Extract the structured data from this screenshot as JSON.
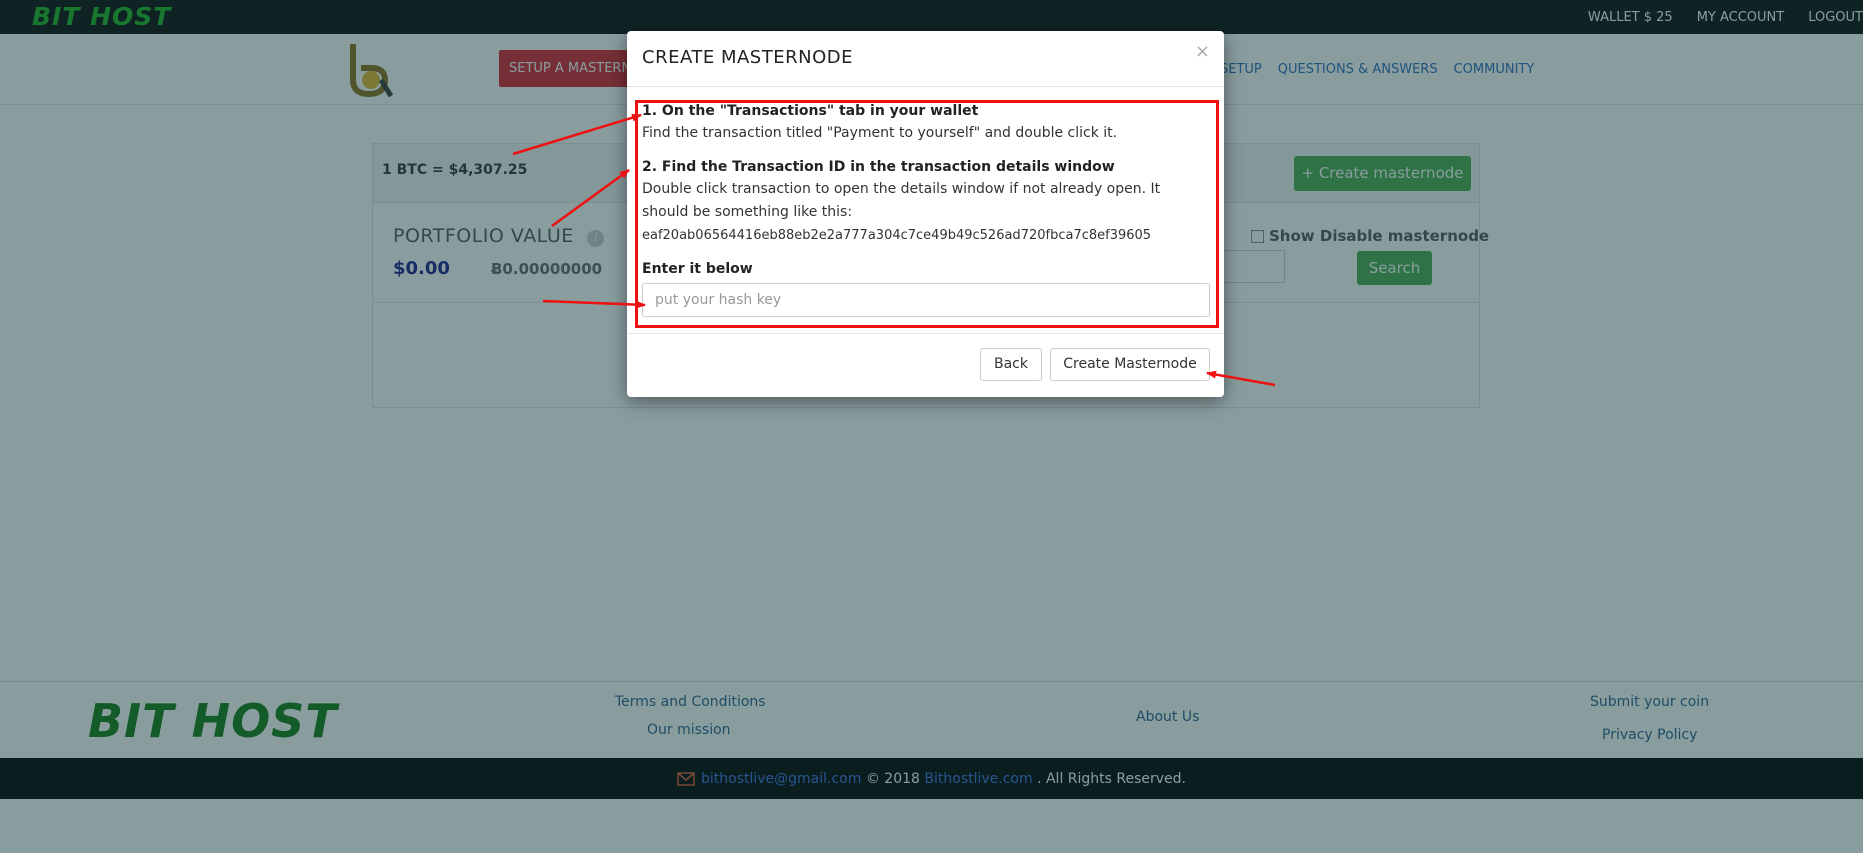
{
  "topbar": {
    "brand": "BIT HOST",
    "links": [
      "WALLET $ 25",
      "MY ACCOUNT",
      "LOGOUT"
    ]
  },
  "navbar": {
    "setup_label": "SETUP A MASTERNODE",
    "links": [
      "SETUP",
      "QUESTIONS & ANSWERS",
      "COMMUNITY"
    ]
  },
  "main": {
    "btc_rate": "1 BTC = $4,307.25",
    "create_label": "+ Create masternode",
    "portfolio_label": "PORTFOLIO VALUE",
    "portfolio_usd": "$0.00",
    "portfolio_btc": "Ƀ0.00000000",
    "show_disable_label": "Show Disable masternode",
    "search_label": "Search"
  },
  "modal": {
    "title": "CREATE MASTERNODE",
    "close": "×",
    "step1_title": "1. On the \"Transactions\" tab in your wallet",
    "step1_text": "Find the transaction titled \"Payment to yourself\" and double click it.",
    "step2_title": "2. Find the Transaction ID in the transaction details window",
    "step2_text": "Double click transaction to open the details window if not already open. It should be something like this:",
    "example_hash": "eaf20ab06564416eb88eb2e2a777a304c7ce49b49c526ad720fbca7c8ef39605",
    "enter_label": "Enter it below",
    "input_placeholder": "put your hash key",
    "back_label": "Back",
    "create_label": "Create Masternode"
  },
  "footer": {
    "logo": "BIT HOST",
    "terms": "Terms and Conditions",
    "mission": "Our mission",
    "about": "About Us",
    "submit_coin": "Submit your coin",
    "privacy": "Privacy Policy",
    "email": "bithostlive@gmail.com",
    "copyright": "© 2018",
    "site": "Bithostlive.com",
    "rights": ". All Rights Reserved."
  },
  "colors": {
    "brand_green": "#1fb31f",
    "setup_red": "#d9232d",
    "button_green": "#49a84a",
    "annotation_red": "#ee1111",
    "link_blue": "#2a6ab8"
  }
}
